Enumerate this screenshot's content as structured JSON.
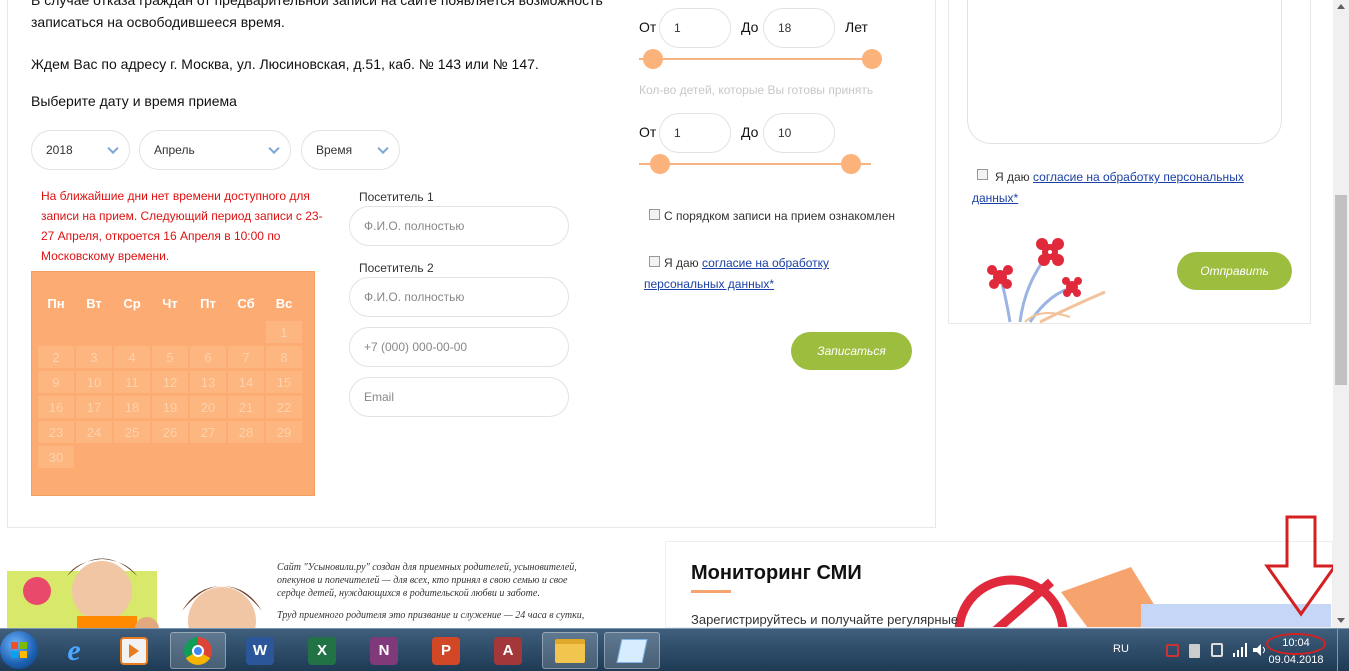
{
  "intro": {
    "line1": "В случае отказа граждан от предварительной записи на сайте появляется возможность",
    "line2": "записаться на освободившееся время.",
    "address": "Ждем Вас по адресу г. Москва, ул. Люсиновская, д.51, каб. № 143 или № 147.",
    "choose": "Выберите дату и время приема"
  },
  "selects": {
    "year": "2018",
    "month": "Апрель",
    "time": "Время"
  },
  "warning": {
    "l1": "На ближайшие дни нет времени доступного для",
    "l2": "записи на прием. Следующий период записи с 23-",
    "l3": "27 Апреля, откроется 16 Апреля в 10:00 по",
    "l4": "Московскому времени."
  },
  "calendar": {
    "weekdays": [
      "Пн",
      "Вт",
      "Ср",
      "Чт",
      "Пт",
      "Сб",
      "Вс"
    ],
    "days": [
      "1",
      "2",
      "3",
      "4",
      "5",
      "6",
      "7",
      "8",
      "9",
      "10",
      "11",
      "12",
      "13",
      "14",
      "15",
      "16",
      "17",
      "18",
      "19",
      "20",
      "21",
      "22",
      "23",
      "24",
      "25",
      "26",
      "27",
      "28",
      "29",
      "30"
    ]
  },
  "form": {
    "visitor1_label": "Посетитель 1",
    "visitor1_placeholder": "Ф.И.О. полностью",
    "visitor2_label": "Посетитель 2",
    "visitor2_placeholder": "Ф.И.О. полностью",
    "phone_placeholder": "+7 (000) 000-00-00",
    "email_placeholder": "Email"
  },
  "age": {
    "from_label": "От",
    "from_value": "1",
    "to_label": "До",
    "to_value": "18",
    "unit": "Лет",
    "range_fraction": [
      0.0,
      1.0
    ]
  },
  "kids": {
    "label": "Кол-во детей, которые Вы готовы принять",
    "from_label": "От",
    "from_value": "1",
    "to_label": "До",
    "to_value": "10",
    "range_fraction": [
      0.0,
      1.0
    ]
  },
  "checks": {
    "order": "С порядком записи на прием ознакомлен",
    "consent_prefix": "Я даю ",
    "consent_link_1": "согласие на обработку",
    "consent_link_2": "персональных данных*"
  },
  "submit_label": "Записаться",
  "side": {
    "consent_prefix": "Я даю ",
    "consent_link_1": "согласие на обработку персональных",
    "consent_link_2": "данных*",
    "send_label": "Отправить"
  },
  "footer": {
    "about_l1": "Сайт \"Усыновили.ру\" создан для приемных родителей, усыновителей,",
    "about_l2": "опекунов и попечителей — для всех, кто принял в свою семью и свое",
    "about_l3": "сердце детей, нуждающихся в родительской любви и заботе.",
    "about_l4": "Труд приемного родителя это призвание и служение — 24 часа в сутки,",
    "media_title": "Мониторинг СМИ",
    "media_text": "Зарегистрируйтесь и получайте регулярные"
  },
  "taskbar": {
    "lang": "RU",
    "time": "10:04",
    "date": "09.04.2018",
    "apps": [
      "start-orb",
      "internet-explorer",
      "media-player",
      "chrome",
      "word",
      "excel",
      "onenote",
      "powerpoint",
      "access",
      "file-explorer",
      "notepad"
    ]
  },
  "colors": {
    "accent_orange": "#fcab72",
    "button_green": "#9dbd3e",
    "warning_red": "#dd1111",
    "annotation_red": "#d42020"
  }
}
